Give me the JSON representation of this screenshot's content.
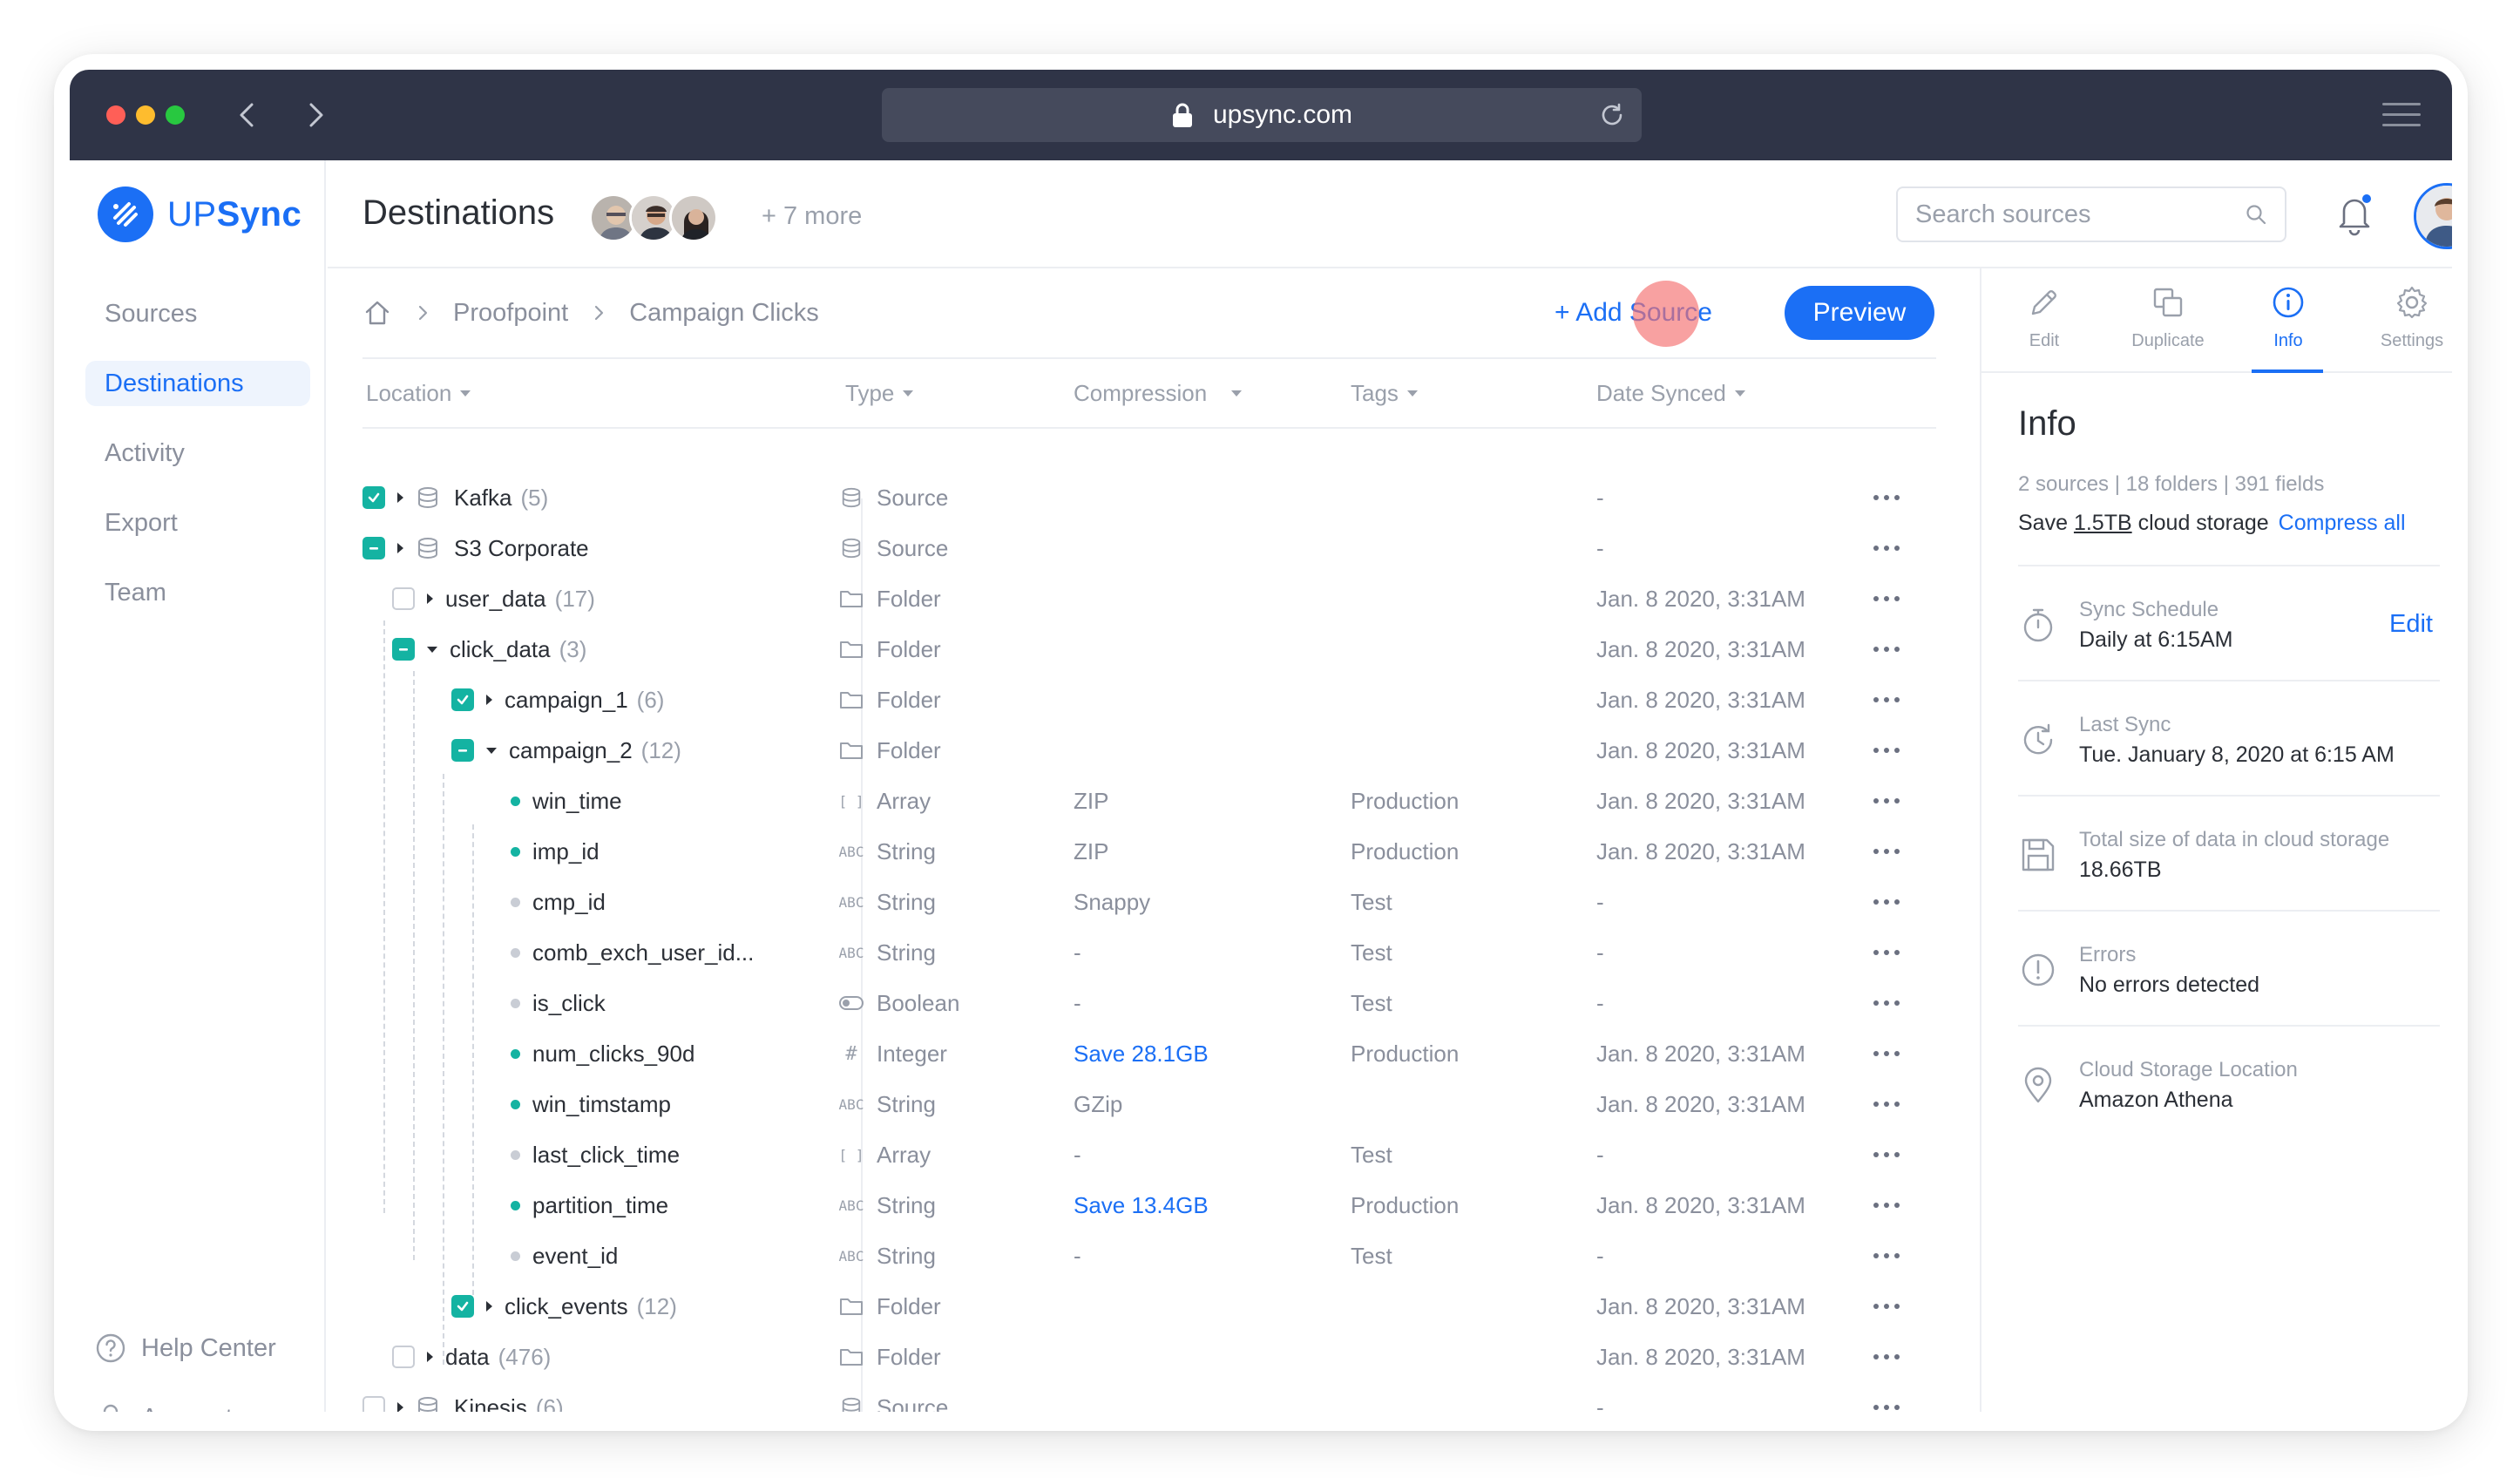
{
  "browser": {
    "url": "upsync.com",
    "traffic_colors": [
      "#ff5f57",
      "#febc2e",
      "#28c840"
    ]
  },
  "brand": {
    "logo_prefix": "UP",
    "logo_suffix": "Sync",
    "accent": "#1b6ff5",
    "teal": "#14b3a2"
  },
  "sidebar": {
    "items": [
      {
        "label": "Sources",
        "active": false
      },
      {
        "label": "Destinations",
        "active": true
      },
      {
        "label": "Activity",
        "active": false
      },
      {
        "label": "Export",
        "active": false
      },
      {
        "label": "Team",
        "active": false
      }
    ],
    "help": "Help Center",
    "account": "Account"
  },
  "header": {
    "title": "Destinations",
    "more": "+ 7 more",
    "search_placeholder": "Search sources"
  },
  "breadcrumb": {
    "items": [
      "Proofpoint",
      "Campaign Clicks"
    ]
  },
  "actions": {
    "add_source": "+ Add Source",
    "preview": "Preview"
  },
  "table": {
    "headers": [
      "Location",
      "Type",
      "Compression",
      "Tags",
      "Date Synced"
    ],
    "rows": [
      {
        "name": "Kafka",
        "count": "(5)",
        "type": "Source",
        "compression": "",
        "tags": "",
        "date": "-"
      },
      {
        "name": "S3 Corporate",
        "count": "",
        "type": "Source",
        "compression": "",
        "tags": "",
        "date": "-"
      },
      {
        "name": "user_data",
        "count": "(17)",
        "type": "Folder",
        "compression": "",
        "tags": "",
        "date": "Jan. 8 2020, 3:31AM"
      },
      {
        "name": "click_data",
        "count": "(3)",
        "type": "Folder",
        "compression": "",
        "tags": "",
        "date": "Jan. 8 2020, 3:31AM"
      },
      {
        "name": "campaign_1",
        "count": "(6)",
        "type": "Folder",
        "compression": "",
        "tags": "",
        "date": "Jan. 8 2020, 3:31AM"
      },
      {
        "name": "campaign_2",
        "count": "(12)",
        "type": "Folder",
        "compression": "",
        "tags": "",
        "date": "Jan. 8 2020, 3:31AM"
      },
      {
        "name": "win_time",
        "count": "",
        "type": "Array",
        "compression": "ZIP",
        "tags": "Production",
        "date": "Jan. 8 2020, 3:31AM"
      },
      {
        "name": "imp_id",
        "count": "",
        "type": "String",
        "compression": "ZIP",
        "tags": "Production",
        "date": "Jan. 8 2020, 3:31AM"
      },
      {
        "name": "cmp_id",
        "count": "",
        "type": "String",
        "compression": "Snappy",
        "tags": "Test",
        "date": "-"
      },
      {
        "name": "comb_exch_user_id...",
        "count": "",
        "type": "String",
        "compression": "-",
        "tags": "Test",
        "date": "-"
      },
      {
        "name": "is_click",
        "count": "",
        "type": "Boolean",
        "compression": "-",
        "tags": "Test",
        "date": "-"
      },
      {
        "name": "num_clicks_90d",
        "count": "",
        "type": "Integer",
        "compression": "Save 28.1GB",
        "tags": "Production",
        "date": "Jan. 8 2020, 3:31AM"
      },
      {
        "name": "win_timstamp",
        "count": "",
        "type": "String",
        "compression": "GZip",
        "tags": "",
        "date": "Jan. 8 2020, 3:31AM"
      },
      {
        "name": "last_click_time",
        "count": "",
        "type": "Array",
        "compression": "-",
        "tags": "Test",
        "date": "-"
      },
      {
        "name": "partition_time",
        "count": "",
        "type": "String",
        "compression": "Save 13.4GB",
        "tags": "Production",
        "date": "Jan. 8 2020, 3:31AM"
      },
      {
        "name": "event_id",
        "count": "",
        "type": "String",
        "compression": "-",
        "tags": "Test",
        "date": "-"
      },
      {
        "name": "click_events",
        "count": "(12)",
        "type": "Folder",
        "compression": "",
        "tags": "",
        "date": "Jan. 8 2020, 3:31AM"
      },
      {
        "name": "data",
        "count": "(476)",
        "type": "Folder",
        "compression": "",
        "tags": "",
        "date": "Jan. 8 2020, 3:31AM"
      },
      {
        "name": "Kinesis",
        "count": "(6)",
        "type": "Source",
        "compression": "",
        "tags": "",
        "date": "-"
      }
    ]
  },
  "panel": {
    "tabs": [
      "Edit",
      "Duplicate",
      "Info",
      "Settings"
    ],
    "title": "Info",
    "stats": "2 sources  |  18 folders  |  391 fields",
    "save_prefix": "Save",
    "save_amount": "1.5TB",
    "save_suffix": "cloud storage",
    "compress_all": "Compress all",
    "details": [
      {
        "label": "Sync Schedule",
        "value": "Daily at 6:15AM",
        "action": "Edit"
      },
      {
        "label": "Last Sync",
        "value": "Tue. January 8, 2020 at 6:15 AM"
      },
      {
        "label": "Total size of data in cloud storage",
        "value": "18.66TB"
      },
      {
        "label": "Errors",
        "value": "No errors detected"
      },
      {
        "label": "Cloud Storage Location",
        "value": "Amazon Athena"
      }
    ]
  }
}
